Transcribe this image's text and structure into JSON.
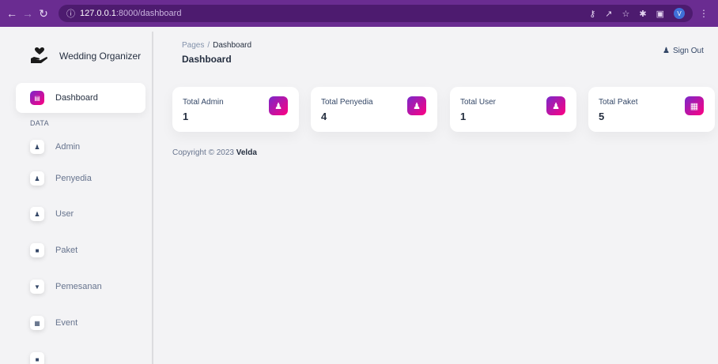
{
  "browser": {
    "url_host": "127.0.0.1",
    "url_path": ":8000/dashboard",
    "profile_initial": "V"
  },
  "sidebar": {
    "brand": "Wedding Organizer",
    "section_label": "DATA",
    "items": [
      {
        "label": "Dashboard",
        "icon": "store-icon",
        "active": true
      },
      {
        "label": "Admin",
        "icon": "users-icon"
      },
      {
        "label": "Penyedia",
        "icon": "users-icon"
      },
      {
        "label": "User",
        "icon": "users-icon"
      },
      {
        "label": "Paket",
        "icon": "gift-icon"
      },
      {
        "label": "Pemesanan",
        "icon": "cart-icon"
      },
      {
        "label": "Event",
        "icon": "calendar-icon"
      },
      {
        "label": "",
        "icon": "partial-icon"
      }
    ]
  },
  "header": {
    "breadcrumb_root": "Pages",
    "breadcrumb_current": "Dashboard",
    "title": "Dashboard",
    "signout_label": "Sign Out"
  },
  "cards": [
    {
      "label": "Total Admin",
      "value": "1",
      "icon": "user-icon"
    },
    {
      "label": "Total Penyedia",
      "value": "4",
      "icon": "user-icon"
    },
    {
      "label": "Total User",
      "value": "1",
      "icon": "user-icon"
    },
    {
      "label": "Total Paket",
      "value": "5",
      "icon": "building-icon"
    }
  ],
  "footer": {
    "text": "Copyright © 2023 ",
    "author": "Velda"
  },
  "colors": {
    "browser_bar": "#6a2c91",
    "accent_gradient_start": "#7928ca",
    "accent_gradient_end": "#ff0080"
  }
}
